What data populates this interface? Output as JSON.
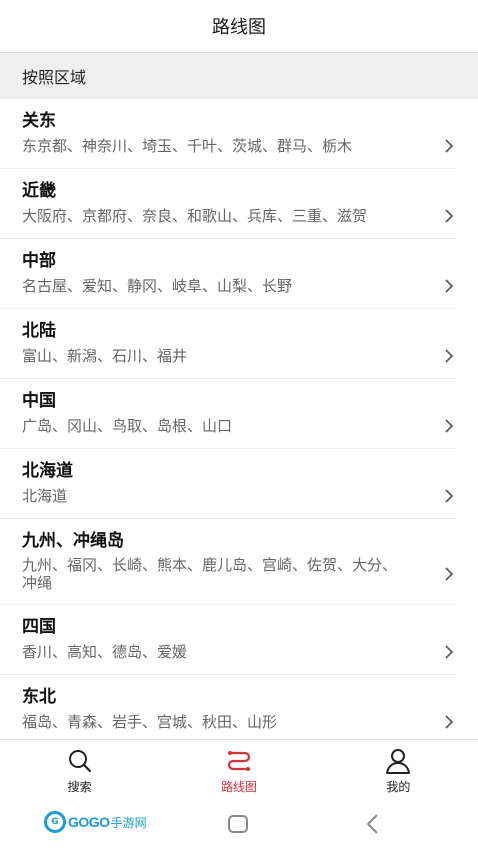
{
  "header": {
    "title": "路线图"
  },
  "section": {
    "label": "按照区域"
  },
  "regions": [
    {
      "title": "关东",
      "subtitle": "东京都、神奈川、埼玉、千叶、茨城、群马、栃木"
    },
    {
      "title": "近畿",
      "subtitle": "大阪府、京都府、奈良、和歌山、兵库、三重、滋贺"
    },
    {
      "title": "中部",
      "subtitle": "名古屋、爱知、静冈、岐阜、山梨、长野"
    },
    {
      "title": "北陆",
      "subtitle": "富山、新潟、石川、福井"
    },
    {
      "title": "中国",
      "subtitle": "广岛、冈山、鸟取、岛根、山口"
    },
    {
      "title": "北海道",
      "subtitle": "北海道"
    },
    {
      "title": "九州、冲绳岛",
      "subtitle": "九州、福冈、长崎、熊本、鹿儿岛、宫崎、佐贺、大分、冲绳"
    },
    {
      "title": "四国",
      "subtitle": "香川、高知、德岛、爱媛"
    },
    {
      "title": "东北",
      "subtitle": "福岛、青森、岩手、宫城、秋田、山形"
    }
  ],
  "tabs": [
    {
      "label": "搜索",
      "icon": "search-icon"
    },
    {
      "label": "路线图",
      "icon": "route-icon",
      "active": true
    },
    {
      "label": "我的",
      "icon": "user-icon"
    }
  ],
  "watermark": {
    "brand": "GOGO",
    "sub": "手游网"
  },
  "colors": {
    "accent": "#d6303a",
    "section_bg": "#efefef",
    "text_secondary": "#666666"
  }
}
